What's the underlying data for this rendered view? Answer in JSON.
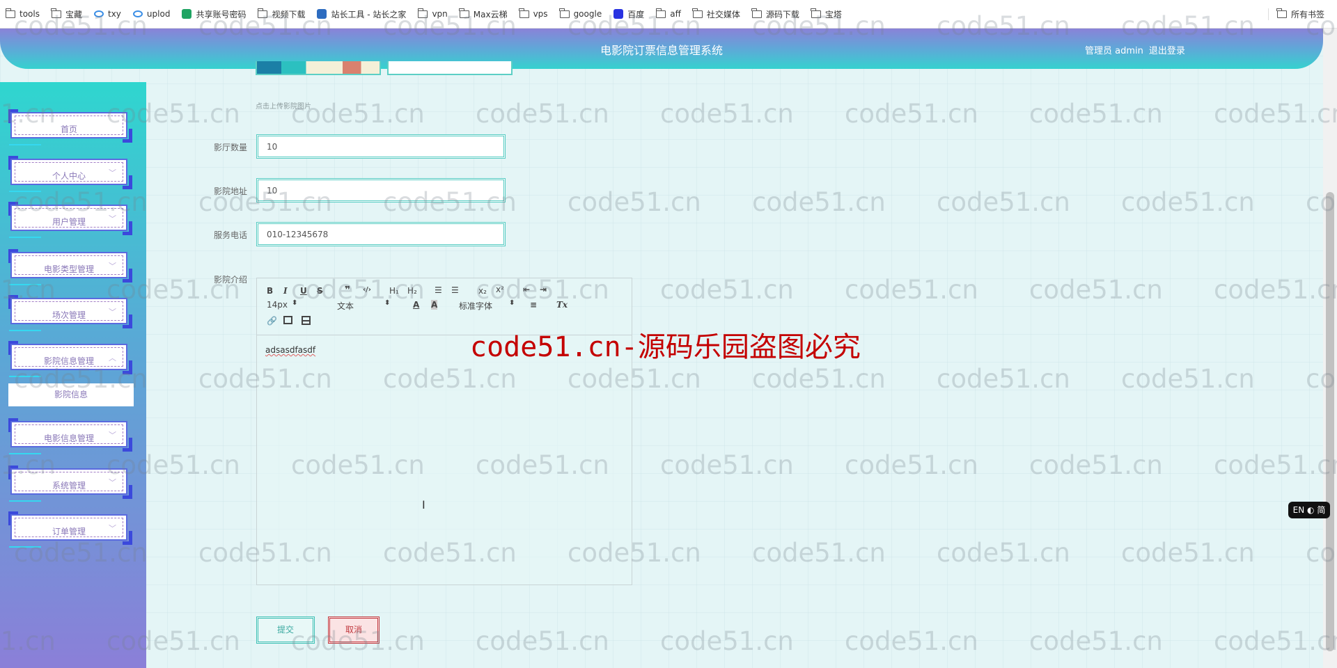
{
  "bookmarks": {
    "items": [
      {
        "label": "tools",
        "icon": "folder-icon"
      },
      {
        "label": "宝藏",
        "icon": "folder-icon"
      },
      {
        "label": "txy",
        "icon": "cloud-icon"
      },
      {
        "label": "uplod",
        "icon": "cloud-icon"
      },
      {
        "label": "共享账号密码",
        "icon": "sheet-icon"
      },
      {
        "label": "视频下载",
        "icon": "folder-icon"
      },
      {
        "label": "站长工具 - 站长之家",
        "icon": "site-icon"
      },
      {
        "label": "vpn",
        "icon": "folder-icon"
      },
      {
        "label": "Max云梯",
        "icon": "folder-icon"
      },
      {
        "label": "vps",
        "icon": "folder-icon"
      },
      {
        "label": "google",
        "icon": "folder-icon"
      },
      {
        "label": "百度",
        "icon": "baidu-icon"
      },
      {
        "label": "aff",
        "icon": "folder-icon"
      },
      {
        "label": "社交媒体",
        "icon": "folder-icon"
      },
      {
        "label": "源码下载",
        "icon": "folder-icon"
      },
      {
        "label": "宝塔",
        "icon": "folder-icon"
      }
    ],
    "all": "所有书签"
  },
  "header": {
    "title": "电影院订票信息管理系统",
    "user": "管理员 admin",
    "logout": "退出登录"
  },
  "sidebar": {
    "items": [
      {
        "label": "首页",
        "expandable": false
      },
      {
        "label": "个人中心",
        "expandable": true
      },
      {
        "label": "用户管理",
        "expandable": true
      },
      {
        "label": "电影类型管理",
        "expandable": true
      },
      {
        "label": "场次管理",
        "expandable": true
      },
      {
        "label": "影院信息管理",
        "expandable": true,
        "expanded": true
      },
      {
        "label": "电影信息管理",
        "expandable": true
      },
      {
        "label": "系统管理",
        "expandable": true
      },
      {
        "label": "订单管理",
        "expandable": true
      }
    ],
    "sub_item": "影院信息"
  },
  "form": {
    "upload_hint": "点击上传影院图片",
    "hall_count": {
      "label": "影厅数量",
      "value": "10"
    },
    "address": {
      "label": "影院地址",
      "value": "10"
    },
    "phone": {
      "label": "服务电话",
      "value": "010-12345678"
    },
    "intro": {
      "label": "影院介绍",
      "content": "adsasdfasdf"
    },
    "toolbar": {
      "b": "B",
      "i": "I",
      "u": "U",
      "s": "S",
      "quote": "❞",
      "code": "‹/›",
      "h1": "H₁",
      "h2": "H₂",
      "ol": "☰",
      "ul": "☰",
      "sub": "x₂",
      "sup": "x²",
      "outdent": "⇤",
      "indent": "⇥",
      "size": "14px",
      "header": "文本",
      "font": "标准字体",
      "clean": "Tx"
    },
    "submit": "提交",
    "cancel": "取消"
  },
  "watermark": "code51.cn",
  "warning": "code51.cn-源码乐园盗图必究",
  "ime": "EN ◐ 简",
  "colors": {
    "accent": "#35d2cf",
    "submit": "#3cbfb4",
    "cancel": "#c0393f",
    "warning": "#c40000"
  }
}
